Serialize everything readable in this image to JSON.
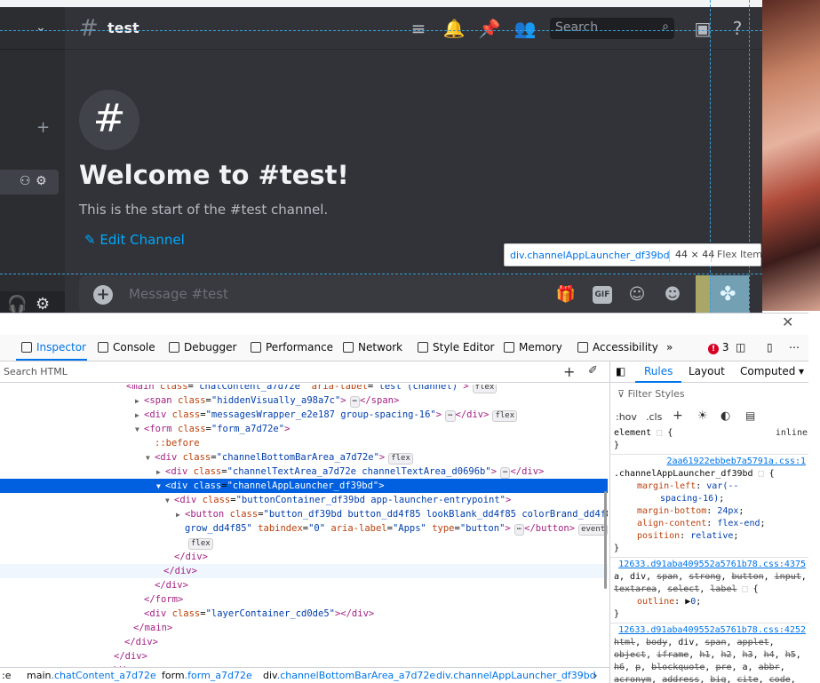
{
  "discord": {
    "channel_name": "test",
    "search_placeholder": "Search",
    "welcome_title": "Welcome to #test!",
    "welcome_subtitle": "This is the start of the #test channel.",
    "edit_channel": "Edit Channel",
    "message_placeholder": "Message #test",
    "gif_label": "GIF"
  },
  "inspector_tooltip": {
    "element": "div.channelAppLauncher_df39bd",
    "dimensions": "44 × 44",
    "flex": "Flex Item"
  },
  "devtools": {
    "tabs": [
      "Inspector",
      "Console",
      "Debugger",
      "Performance",
      "Network",
      "Style Editor",
      "Memory",
      "Accessibility"
    ],
    "error_count": "3",
    "search_html_placeholder": "Search HTML",
    "rules_tabs": [
      "Rules",
      "Layout",
      "Computed"
    ],
    "filter_placeholder": "Filter Styles",
    "hov": ":hov",
    "cls": ".cls",
    "breadcrumbs": [
      {
        "tag": "main",
        "cls": ".chatContent_a7d72e"
      },
      {
        "tag": "form",
        "cls": ".form_a7d72e"
      },
      {
        "tag": "div",
        "cls": ".channelBottomBarArea_a7d72e"
      },
      {
        "tag": "div",
        "cls": ".channelAppLauncher_df39bd"
      }
    ]
  },
  "colors": {
    "discord_bg": "#313338",
    "sidebar_bg": "#2b2d31",
    "link_blue": "#00a8fc",
    "devtools_accent": "#0074e8",
    "selection": "#0060df"
  }
}
